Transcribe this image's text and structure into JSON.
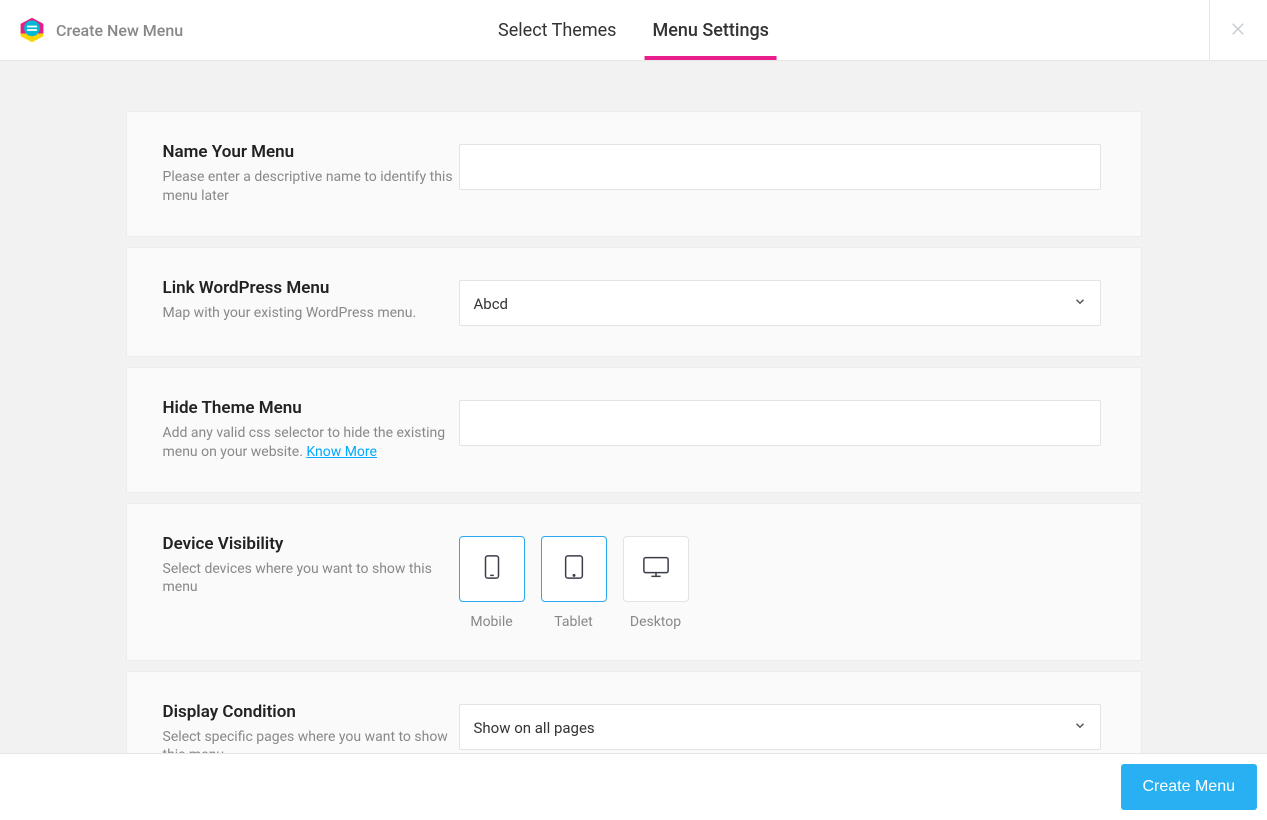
{
  "header": {
    "title": "Create New Menu",
    "tabs": {
      "themes": "Select Themes",
      "settings": "Menu Settings"
    }
  },
  "sections": {
    "name": {
      "title": "Name Your Menu",
      "desc": "Please enter a descriptive name to identify this menu later",
      "value": ""
    },
    "link": {
      "title": "Link WordPress Menu",
      "desc": "Map with your existing WordPress menu.",
      "selected": "Abcd"
    },
    "hide": {
      "title": "Hide Theme Menu",
      "desc": "Add any valid css selector to hide the existing menu on your website. ",
      "link_label": "Know More",
      "value": ""
    },
    "devices": {
      "title": "Device Visibility",
      "desc": "Select devices where you want to show this menu",
      "mobile": "Mobile",
      "tablet": "Tablet",
      "desktop": "Desktop"
    },
    "display": {
      "title": "Display Condition",
      "desc": "Select specific pages where you want to show this menu.",
      "selected": "Show on all pages"
    }
  },
  "footer": {
    "create": "Create Menu"
  }
}
